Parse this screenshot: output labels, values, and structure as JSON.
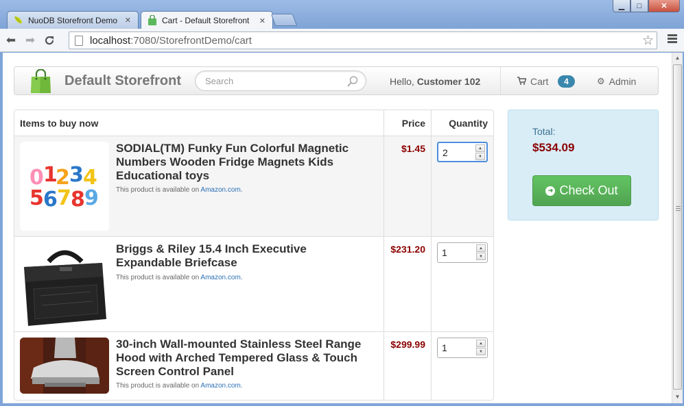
{
  "browser": {
    "tabs": [
      {
        "label": "NuoDB Storefront Demo",
        "active": false
      },
      {
        "label": "Cart - Default Storefront",
        "active": true
      }
    ],
    "url": {
      "host": "localhost",
      "path": ":7080/StorefrontDemo/cart"
    },
    "controls": {
      "minimize": "▁",
      "maximize": "□",
      "close": "✕"
    }
  },
  "navbar": {
    "brand": "Default Storefront",
    "search_placeholder": "Search",
    "hello_prefix": "Hello,",
    "customer": "Customer 102",
    "cart_label": "Cart",
    "cart_count": "4",
    "admin_label": "Admin"
  },
  "cart": {
    "headers": {
      "item": "Items to buy now",
      "price": "Price",
      "quantity": "Quantity"
    },
    "items": [
      {
        "name": "SODIAL(TM) Funky Fun Colorful Magnetic Numbers Wooden Fridge Magnets Kids Educational toys",
        "avail_prefix": "This product is available on",
        "avail_link": "Amazon.com",
        "avail_suffix": ".",
        "price": "$1.45",
        "quantity": "2"
      },
      {
        "name": "Briggs & Riley 15.4 Inch Executive Expandable Briefcase",
        "avail_prefix": "This product is available on",
        "avail_link": "Amazon.com",
        "avail_suffix": ".",
        "price": "$231.20",
        "quantity": "1"
      },
      {
        "name": "30-inch Wall-mounted Stainless Steel Range Hood with Arched Tempered Glass & Touch Screen Control Panel",
        "avail_prefix": "This product is available on",
        "avail_link": "Amazon.com",
        "avail_suffix": ".",
        "price": "$299.99",
        "quantity": "1"
      }
    ]
  },
  "summary": {
    "total_label": "Total:",
    "total_value": "$534.09",
    "checkout_label": "Check Out"
  },
  "colors": {
    "price": "#8b0000",
    "badge": "#3a87ad",
    "checkout": "#51a351",
    "summary_bg": "#d9edf7"
  }
}
